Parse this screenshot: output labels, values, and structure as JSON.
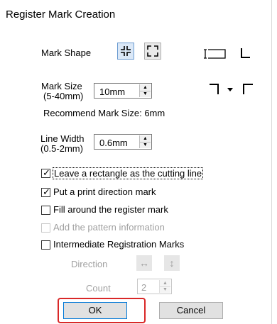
{
  "dialog": {
    "title": "Register Mark Creation"
  },
  "mark_shape": {
    "label": "Mark Shape",
    "icons": [
      "corner-marks-inward-icon",
      "corner-marks-outward-icon"
    ]
  },
  "mark_size": {
    "label_line1": "Mark Size",
    "label_line2": "(5-40mm)",
    "value": "10mm",
    "recommend": "Recommend Mark Size:  6mm"
  },
  "line_width": {
    "label_line1": "Line Width",
    "label_line2": "(0.5-2mm)",
    "value": "0.6mm"
  },
  "options": [
    {
      "label": "Leave a rectangle as the cutting line",
      "checked": true,
      "enabled": true
    },
    {
      "label": "Put a print direction mark",
      "checked": true,
      "enabled": true
    },
    {
      "label": "Fill around the register mark",
      "checked": false,
      "enabled": true
    },
    {
      "label": "Add the pattern information",
      "checked": false,
      "enabled": false
    },
    {
      "label": "Intermediate Registration Marks",
      "checked": false,
      "enabled": true
    }
  ],
  "intermediate": {
    "direction_label": "Direction",
    "count_label": "Count",
    "count_value": "2"
  },
  "buttons": {
    "ok": "OK",
    "cancel": "Cancel"
  },
  "colors": {
    "highlight": "#d92828",
    "disabled": "#a0a0a0",
    "selected_shape": "#dbe8f7"
  }
}
